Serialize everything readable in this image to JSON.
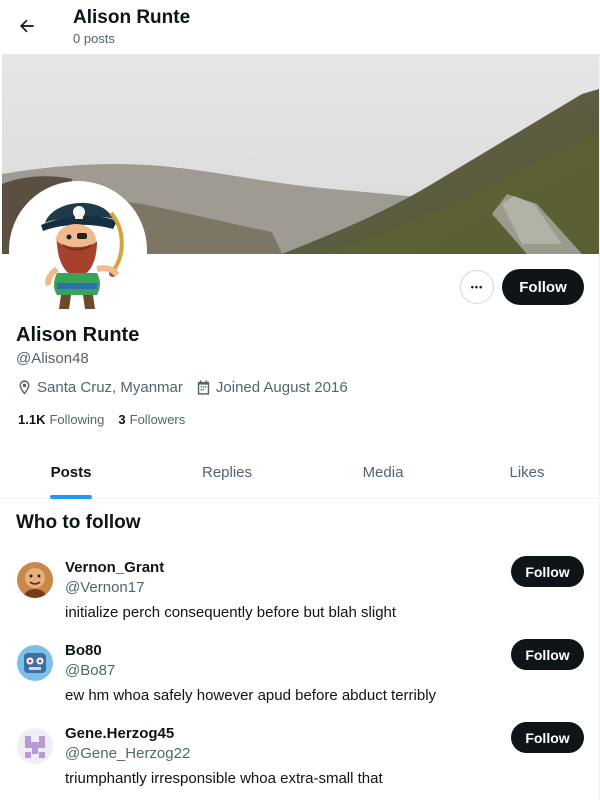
{
  "header": {
    "title": "Alison Runte",
    "subtitle": "0 posts"
  },
  "profile": {
    "display_name": "Alison Runte",
    "handle": "@Alison48",
    "location": "Santa Cruz, Myanmar",
    "joined": "Joined August 2016",
    "following_count": "1.1K",
    "following_label": "Following",
    "followers_count": "3",
    "followers_label": "Followers",
    "follow_label": "Follow",
    "more_label": "•••"
  },
  "tabs": [
    {
      "label": "Posts",
      "active": true
    },
    {
      "label": "Replies",
      "active": false
    },
    {
      "label": "Media",
      "active": false
    },
    {
      "label": "Likes",
      "active": false
    }
  ],
  "who_to_follow": {
    "title": "Who to follow",
    "follow_label": "Follow",
    "items": [
      {
        "name": "Vernon_Grant",
        "handle": "@Vernon17",
        "bio": "initialize perch consequently before but blah slight"
      },
      {
        "name": "Bo80",
        "handle": "@Bo87",
        "bio": "ew hm whoa safely however apud before abduct terribly"
      },
      {
        "name": "Gene.Herzog45",
        "handle": "@Gene_Herzog22",
        "bio": "triumphantly irresponsible whoa extra-small that"
      }
    ]
  },
  "colors": {
    "accent": "#1d9bf0",
    "button_bg": "#0f1419",
    "secondary_text": "#536471"
  }
}
